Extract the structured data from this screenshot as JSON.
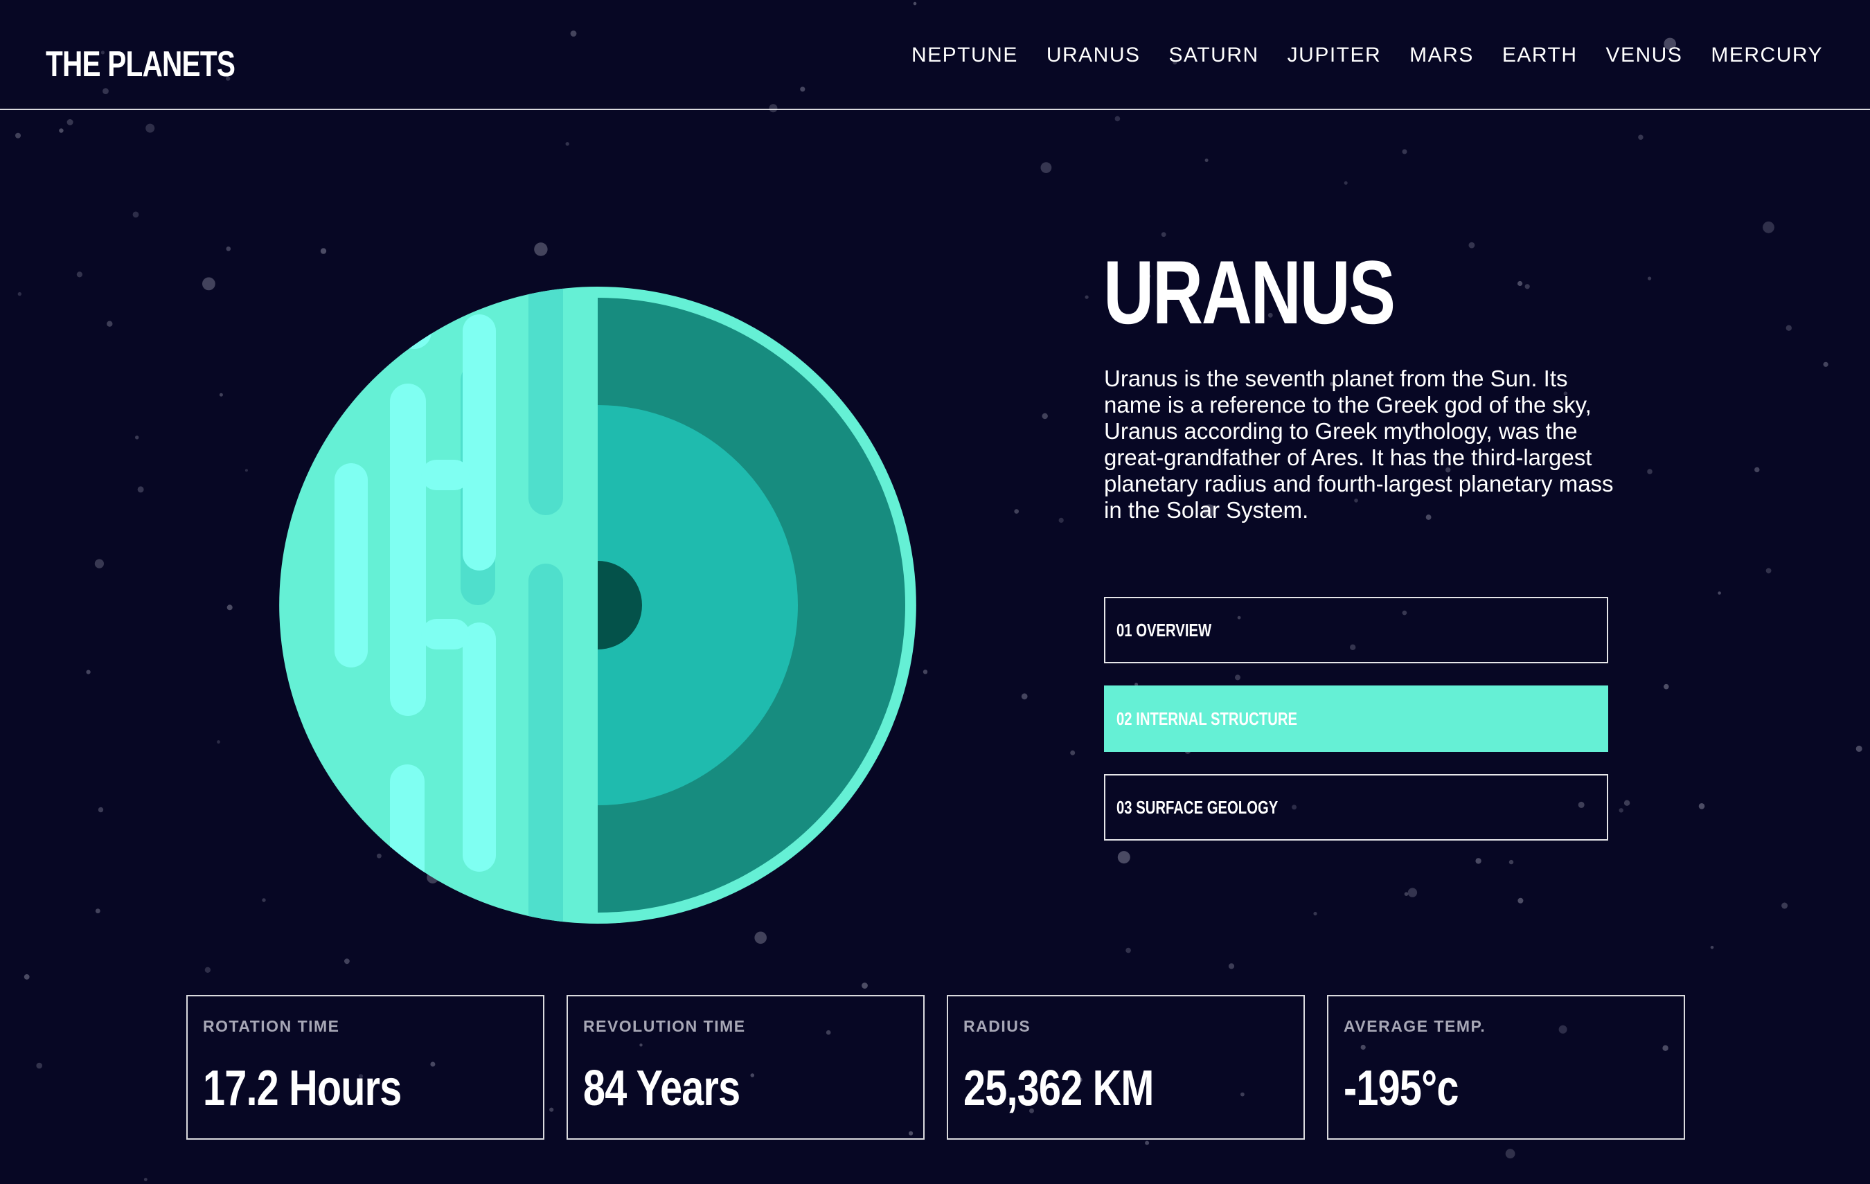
{
  "header": {
    "logo": "THE PLANETS",
    "nav": [
      "NEPTUNE",
      "URANUS",
      "SATURN",
      "JUPITER",
      "MARS",
      "EARTH",
      "VENUS",
      "MERCURY"
    ]
  },
  "planet": {
    "name": "URANUS",
    "description": "Uranus is the seventh planet from the Sun. Its name is a reference to the Greek god of the sky, Uranus according to Greek mythology, was the great-grandfather of Ares. It has the third-largest planetary radius and fourth-largest planetary mass in the Solar System.",
    "image_icon": "planet-internal-structure-icon"
  },
  "tabs": [
    {
      "label": "01 OVERVIEW",
      "active": false
    },
    {
      "label": "02 INTERNAL STRUCTURE",
      "active": true
    },
    {
      "label": "03 SURFACE GEOLOGY",
      "active": false
    }
  ],
  "stats": [
    {
      "label": "ROTATION TIME",
      "value": "17.2 Hours"
    },
    {
      "label": "REVOLUTION TIME",
      "value": "84 Years"
    },
    {
      "label": "RADIUS",
      "value": "25,362 KM"
    },
    {
      "label": "AVERAGE TEMP.",
      "value": "-195°c"
    }
  ],
  "colors": {
    "background": "#070724",
    "accent": "#65f0d5",
    "planet_light": "#65f0d5",
    "planet_stripe": "#7ffff2",
    "planet_stripe_dark": "#4fdfcc",
    "layer_outer": "#178c7f",
    "layer_inner": "#1fbbae",
    "core": "#04524a",
    "label_gray": "#a7a7b6"
  }
}
